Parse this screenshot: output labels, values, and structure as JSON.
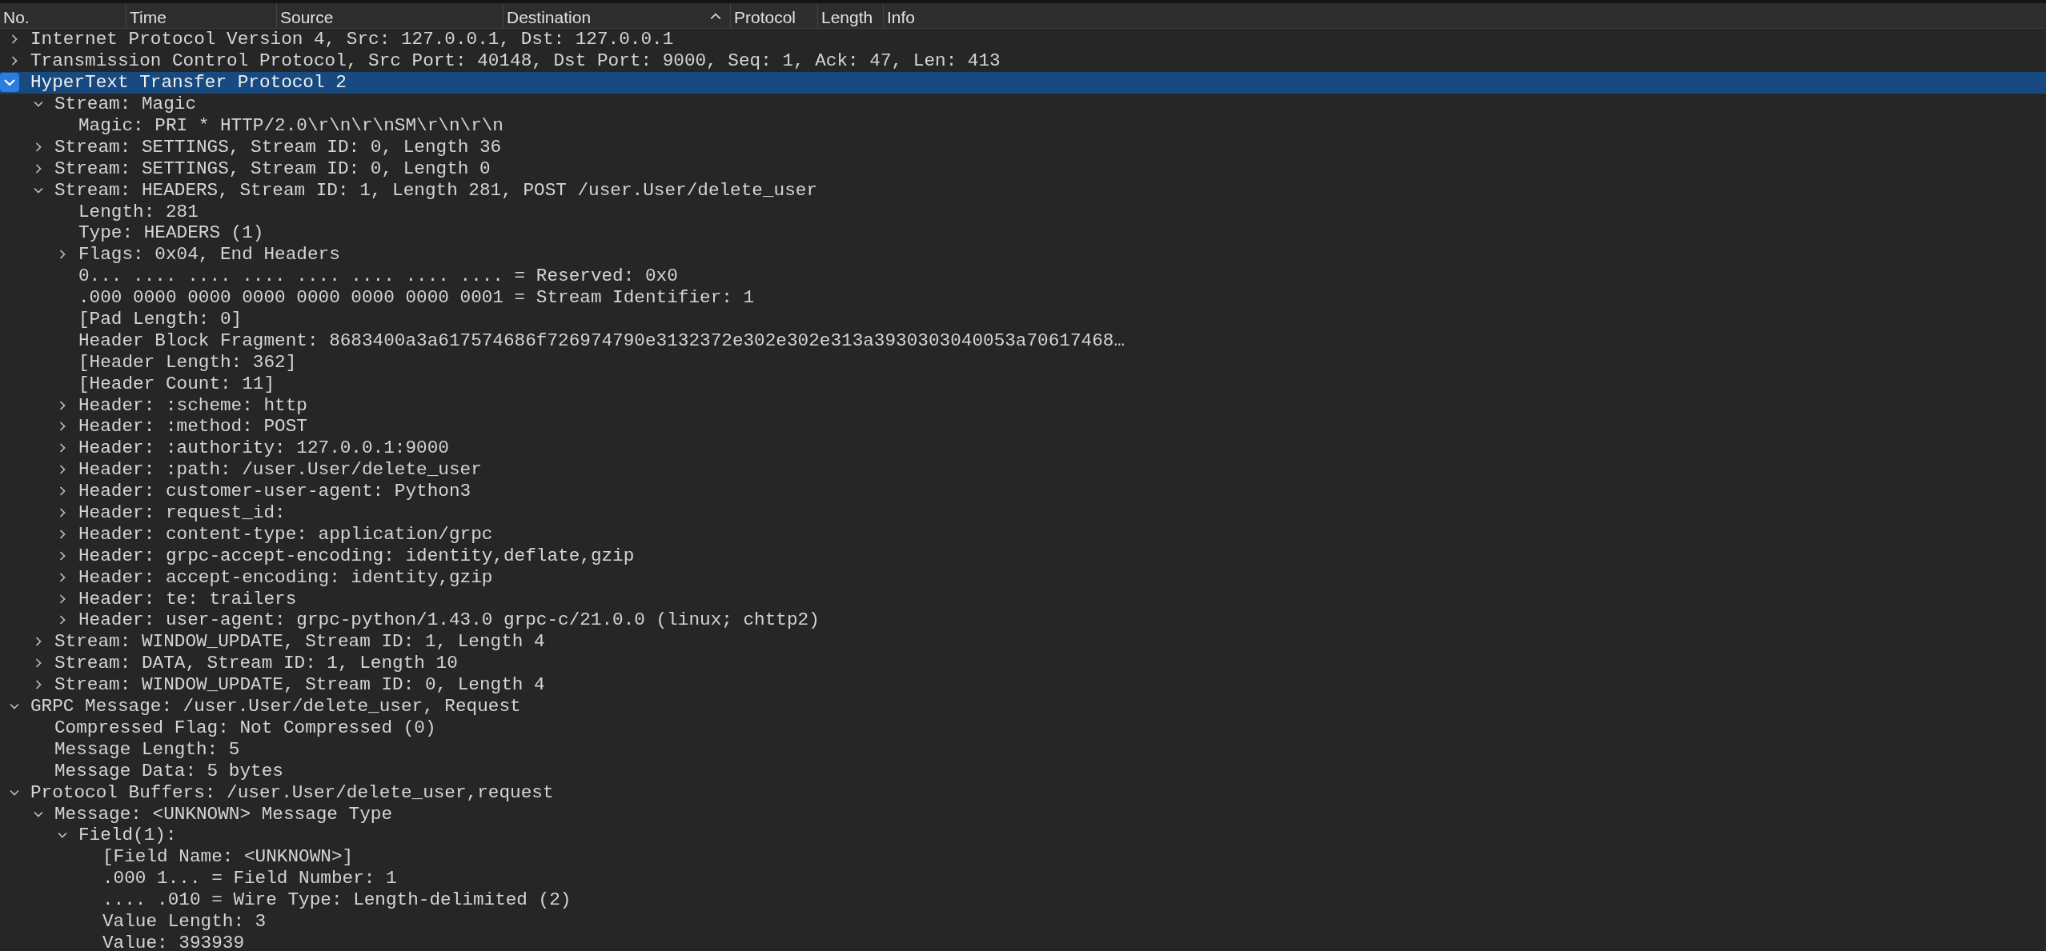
{
  "columns": [
    {
      "label": "No.",
      "sorted": false
    },
    {
      "label": "Time",
      "sorted": false
    },
    {
      "label": "Source",
      "sorted": false
    },
    {
      "label": "Destination",
      "sorted": true
    },
    {
      "label": "Protocol",
      "sorted": false
    },
    {
      "label": "Length",
      "sorted": false
    },
    {
      "label": "Info",
      "sorted": false
    }
  ],
  "tree": [
    {
      "text": "Internet Protocol Version 4, Src: 127.0.0.1, Dst: 127.0.0.1",
      "kind": "branch",
      "expanded": false,
      "selected": false
    },
    {
      "text": "Transmission Control Protocol, Src Port: 40148, Dst Port: 9000, Seq: 1, Ack: 47, Len: 413",
      "kind": "branch",
      "expanded": false,
      "selected": false
    },
    {
      "text": "HyperText Transfer Protocol 2",
      "kind": "branch",
      "expanded": true,
      "selected": true,
      "children": [
        {
          "text": "Stream: Magic",
          "kind": "branch",
          "expanded": true,
          "selected": false,
          "children": [
            {
              "text": "Magic: PRI * HTTP/2.0\\r\\n\\r\\nSM\\r\\n\\r\\n",
              "kind": "leaf",
              "selected": false
            }
          ]
        },
        {
          "text": "Stream: SETTINGS, Stream ID: 0, Length 36",
          "kind": "branch",
          "expanded": false,
          "selected": false
        },
        {
          "text": "Stream: SETTINGS, Stream ID: 0, Length 0",
          "kind": "branch",
          "expanded": false,
          "selected": false
        },
        {
          "text": "Stream: HEADERS, Stream ID: 1, Length 281, POST /user.User/delete_user",
          "kind": "branch",
          "expanded": true,
          "selected": false,
          "children": [
            {
              "text": "Length: 281",
              "kind": "leaf",
              "selected": false
            },
            {
              "text": "Type: HEADERS (1)",
              "kind": "leaf",
              "selected": false
            },
            {
              "text": "Flags: 0x04, End Headers",
              "kind": "branch",
              "expanded": false,
              "selected": false
            },
            {
              "text": "0... .... .... .... .... .... .... .... = Reserved: 0x0",
              "kind": "leaf",
              "selected": false
            },
            {
              "text": ".000 0000 0000 0000 0000 0000 0000 0001 = Stream Identifier: 1",
              "kind": "leaf",
              "selected": false
            },
            {
              "text": "[Pad Length: 0]",
              "kind": "leaf",
              "selected": false
            },
            {
              "text": "Header Block Fragment: 8683400a3a617574686f726974790e3132372e302e302e313a3930303040053a70617468…",
              "kind": "leaf",
              "selected": false
            },
            {
              "text": "[Header Length: 362]",
              "kind": "leaf",
              "selected": false
            },
            {
              "text": "[Header Count: 11]",
              "kind": "leaf",
              "selected": false
            },
            {
              "text": "Header: :scheme: http",
              "kind": "branch",
              "expanded": false,
              "selected": false
            },
            {
              "text": "Header: :method: POST",
              "kind": "branch",
              "expanded": false,
              "selected": false
            },
            {
              "text": "Header: :authority: 127.0.0.1:9000",
              "kind": "branch",
              "expanded": false,
              "selected": false
            },
            {
              "text": "Header: :path: /user.User/delete_user",
              "kind": "branch",
              "expanded": false,
              "selected": false
            },
            {
              "text": "Header: customer-user-agent: Python3",
              "kind": "branch",
              "expanded": false,
              "selected": false
            },
            {
              "text": "Header: request_id:",
              "kind": "branch",
              "expanded": false,
              "selected": false
            },
            {
              "text": "Header: content-type: application/grpc",
              "kind": "branch",
              "expanded": false,
              "selected": false
            },
            {
              "text": "Header: grpc-accept-encoding: identity,deflate,gzip",
              "kind": "branch",
              "expanded": false,
              "selected": false
            },
            {
              "text": "Header: accept-encoding: identity,gzip",
              "kind": "branch",
              "expanded": false,
              "selected": false
            },
            {
              "text": "Header: te: trailers",
              "kind": "branch",
              "expanded": false,
              "selected": false
            },
            {
              "text": "Header: user-agent: grpc-python/1.43.0 grpc-c/21.0.0 (linux; chttp2)",
              "kind": "branch",
              "expanded": false,
              "selected": false
            }
          ]
        },
        {
          "text": "Stream: WINDOW_UPDATE, Stream ID: 1, Length 4",
          "kind": "branch",
          "expanded": false,
          "selected": false
        },
        {
          "text": "Stream: DATA, Stream ID: 1, Length 10",
          "kind": "branch",
          "expanded": false,
          "selected": false
        },
        {
          "text": "Stream: WINDOW_UPDATE, Stream ID: 0, Length 4",
          "kind": "branch",
          "expanded": false,
          "selected": false
        }
      ]
    },
    {
      "text": "GRPC Message: /user.User/delete_user, Request",
      "kind": "branch",
      "expanded": true,
      "selected": false,
      "children": [
        {
          "text": "Compressed Flag: Not Compressed (0)",
          "kind": "leaf",
          "selected": false
        },
        {
          "text": "Message Length: 5",
          "kind": "leaf",
          "selected": false
        },
        {
          "text": "Message Data: 5 bytes",
          "kind": "leaf",
          "selected": false
        }
      ]
    },
    {
      "text": "Protocol Buffers: /user.User/delete_user,request",
      "kind": "branch",
      "expanded": true,
      "selected": false,
      "children": [
        {
          "text": "Message: <UNKNOWN> Message Type",
          "kind": "branch",
          "expanded": true,
          "selected": false,
          "children": [
            {
              "text": "Field(1):",
              "kind": "branch",
              "expanded": true,
              "selected": false,
              "children": [
                {
                  "text": "[Field Name: <UNKNOWN>]",
                  "kind": "leaf",
                  "selected": false
                },
                {
                  "text": ".000 1... = Field Number: 1",
                  "kind": "leaf",
                  "selected": false
                },
                {
                  "text": ".... .010 = Wire Type: Length-delimited (2)",
                  "kind": "leaf",
                  "selected": false
                },
                {
                  "text": "Value Length: 3",
                  "kind": "leaf",
                  "selected": false
                },
                {
                  "text": "Value: 393939",
                  "kind": "leaf",
                  "selected": false
                }
              ]
            }
          ]
        }
      ]
    }
  ]
}
